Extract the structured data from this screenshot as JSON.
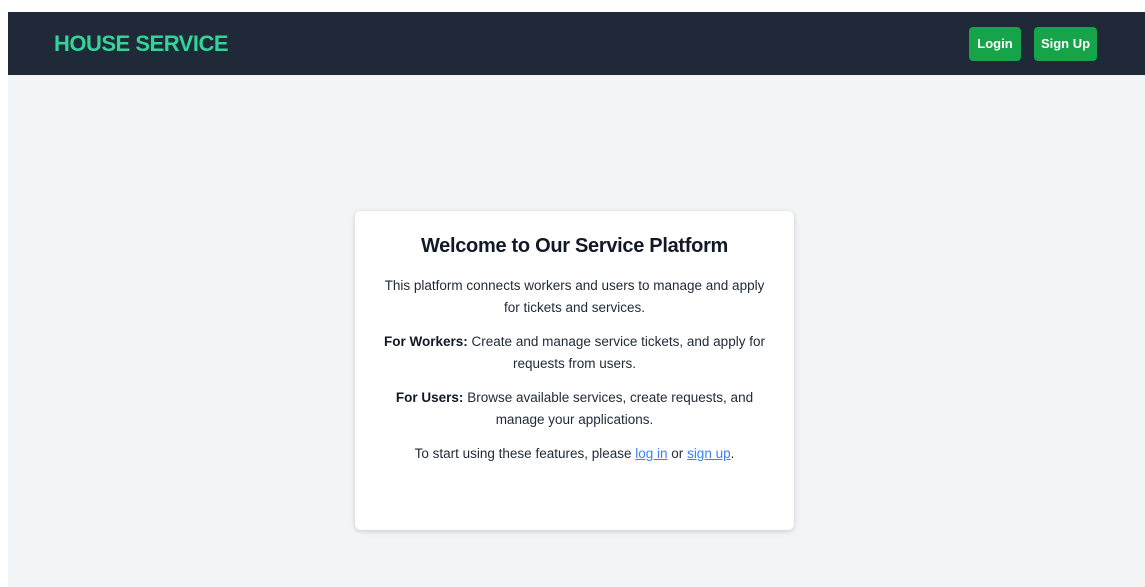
{
  "navbar": {
    "brand": "HOUSE SERVICE",
    "login_label": "Login",
    "signup_label": "Sign Up"
  },
  "card": {
    "title": "Welcome to Our Service Platform",
    "intro": "This platform connects workers and users to manage and apply for tickets and services.",
    "workers_label": "For Workers:",
    "workers_text": " Create and manage service tickets, and apply for requests from users.",
    "users_label": "For Users:",
    "users_text": " Browse available services, create requests, and manage your applications.",
    "cta_prefix": "To start using these features, please ",
    "login_link": "log in",
    "cta_or": " or ",
    "signup_link": "sign up",
    "cta_suffix": "."
  },
  "colors": {
    "navbar_bg": "#1f2937",
    "brand": "#34d399",
    "button": "#16a34a",
    "page_bg": "#f3f4f6",
    "link": "#3b82f6"
  }
}
